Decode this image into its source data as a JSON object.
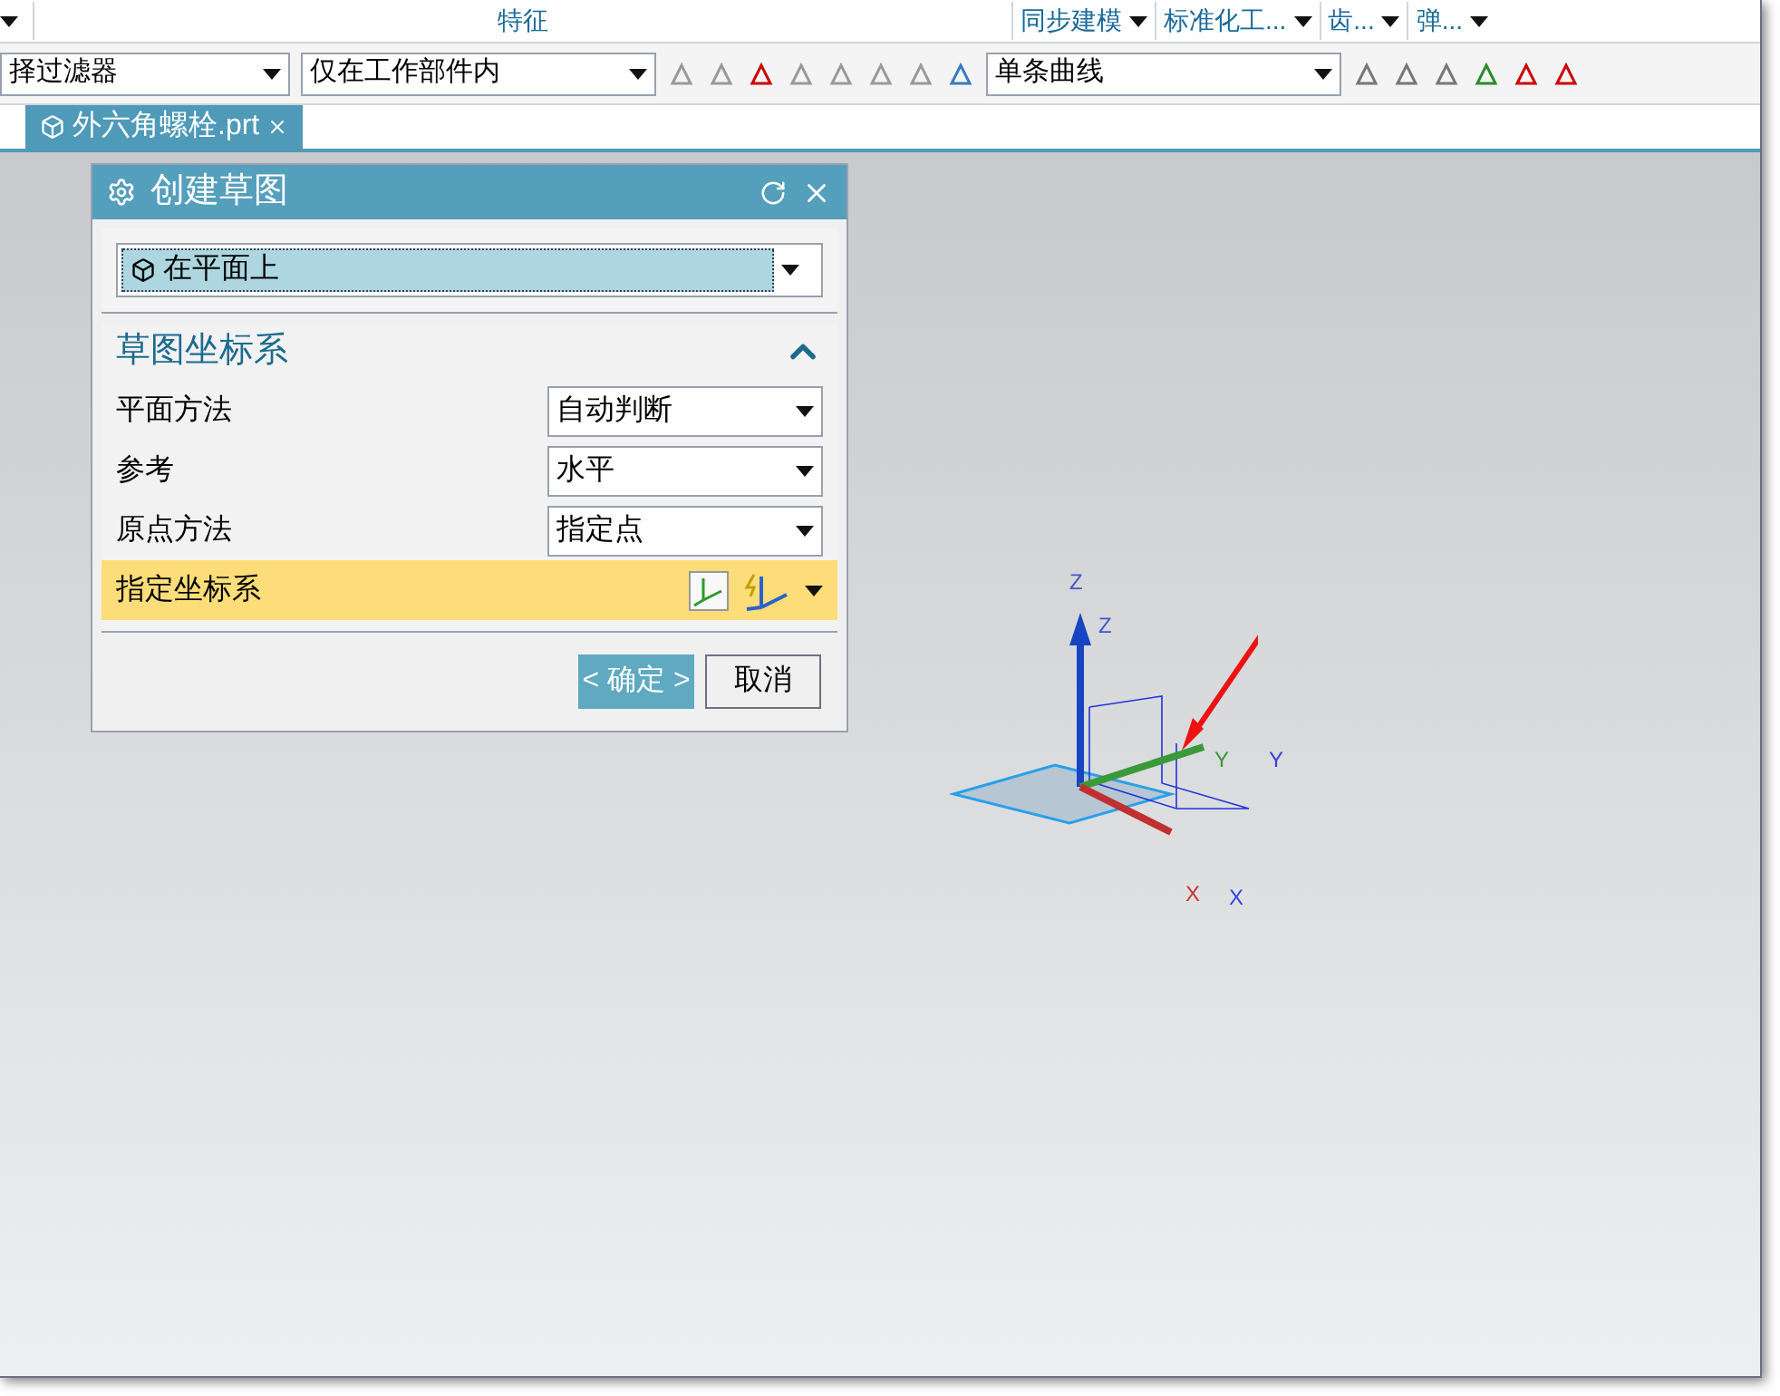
{
  "ribbon_groups": [
    {
      "label": "特征",
      "kind": "wide"
    },
    {
      "label": "同步建模",
      "kind": "dropdown"
    },
    {
      "label": "标准化工...",
      "kind": "dropdown"
    },
    {
      "label": "齿...",
      "kind": "dropdown"
    },
    {
      "label": "弹...",
      "kind": "dropdown"
    }
  ],
  "toolbar": {
    "filters": [
      "择过滤器",
      "仅在工作部件内"
    ],
    "curve_rule": "单条曲线"
  },
  "tabs": [
    {
      "label": "外六角螺栓.prt",
      "selected": true
    }
  ],
  "dialog": {
    "title": "创建草图",
    "type": "在平面上",
    "section": {
      "title": "草图坐标系",
      "expanded": true,
      "rows": [
        {
          "kind": "dropdown",
          "label": "平面方法",
          "value": "自动判断",
          "highlighted": false
        },
        {
          "kind": "dropdown",
          "label": "参考",
          "value": "水平",
          "highlighted": false
        },
        {
          "kind": "dropdown",
          "label": "原点方法",
          "value": "指定点",
          "highlighted": false
        },
        {
          "kind": "selector",
          "label": "指定坐标系",
          "highlighted": true
        }
      ]
    },
    "buttons": [
      {
        "label": "< 确定 >",
        "default": true
      },
      {
        "label": "取消",
        "default": false
      }
    ]
  },
  "viewport": {
    "axis_labels": {
      "z": [
        "Z",
        "Z"
      ],
      "y": [
        "Y",
        "Y"
      ],
      "x": [
        "X",
        "X"
      ]
    }
  }
}
